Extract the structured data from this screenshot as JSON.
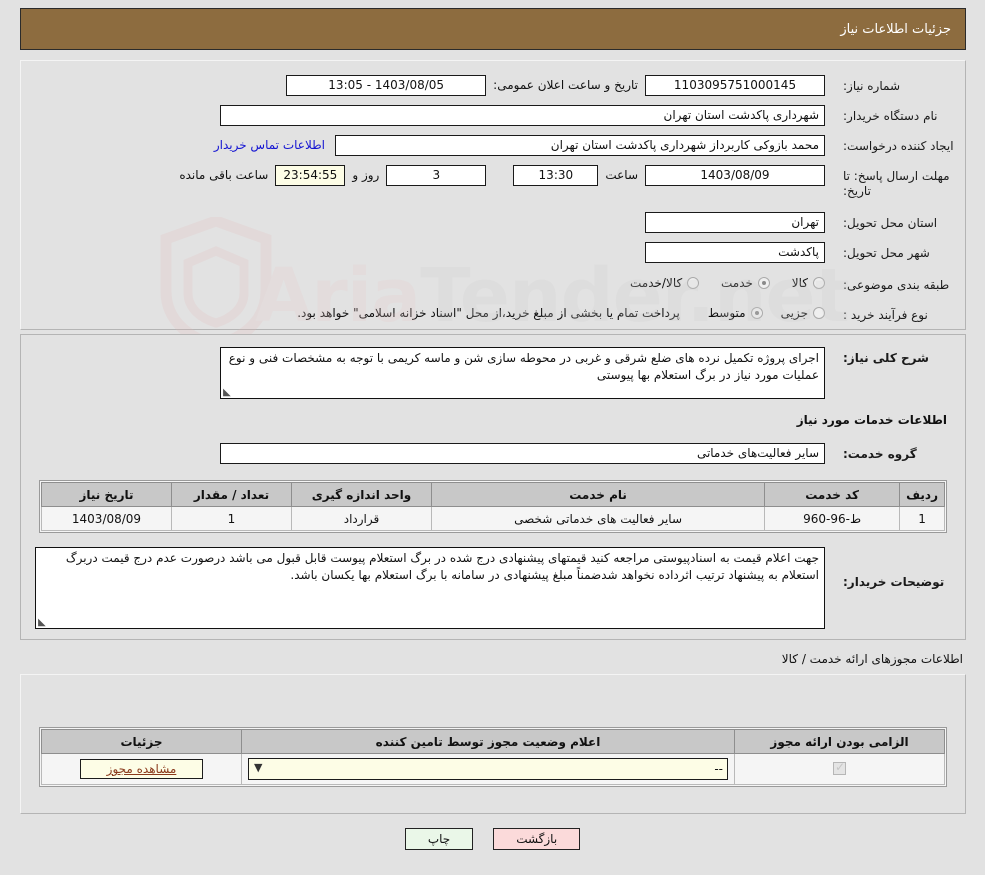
{
  "header": {
    "title": "جزئیات اطلاعات نیاز"
  },
  "fields": {
    "need_number_label": "شماره نیاز:",
    "need_number_value": "1103095751000145",
    "public_announce_label": "تاریخ و ساعت اعلان عمومی:",
    "public_announce_value": "1403/08/05 - 13:05",
    "buyer_org_label": "نام دستگاه خریدار:",
    "buyer_org_value": "شهرداری پاکدشت استان تهران",
    "requester_label": "ایجاد کننده درخواست:",
    "requester_value": "محمد بازوکی کاربرداز شهرداری پاکدشت استان تهران",
    "buyer_contact_link": "اطلاعات تماس خریدار",
    "deadline_label": "مهلت ارسال پاسخ: تا تاریخ:",
    "deadline_date": "1403/08/09",
    "deadline_hour_label": "ساعت",
    "deadline_hour": "13:30",
    "remaining_days": "3",
    "remaining_days_label": "روز و",
    "remaining_time": "23:54:55",
    "remaining_time_label": "ساعت باقی مانده",
    "province_label": "استان محل تحویل:",
    "province_value": "تهران",
    "city_label": "شهر محل تحویل:",
    "city_value": "پاکدشت",
    "category_label": "طبقه بندی موضوعی:",
    "process_label": "نوع فرآیند خرید :",
    "treasury_note": "پرداخت تمام یا بخشی از مبلغ خرید،از محل \"اسناد خزانه اسلامی\" خواهد بود."
  },
  "category_options": [
    {
      "label": "کالا",
      "selected": false
    },
    {
      "label": "خدمت",
      "selected": true
    },
    {
      "label": "کالا/خدمت",
      "selected": false
    }
  ],
  "process_options": [
    {
      "label": "جزیی",
      "selected": false
    },
    {
      "label": "متوسط",
      "selected": true
    }
  ],
  "description": {
    "label": "شرح کلی نیاز:",
    "value": "اجرای پروژه تکمیل نرده های ضلع شرقی و غربی در محوطه سازی شن و ماسه کریمی با توجه به مشخصات فنی و نوع عملیات مورد نیاز در برگ استعلام بها پیوستی"
  },
  "services_section": {
    "heading": "اطلاعات خدمات مورد نیاز",
    "group_label": "گروه خدمت:",
    "group_value": "سایر فعالیت‌های خدماتی"
  },
  "services_table": {
    "columns": [
      "ردیف",
      "کد خدمت",
      "نام خدمت",
      "واحد اندازه گیری",
      "تعداد / مقدار",
      "تاریخ نیاز"
    ],
    "rows": [
      {
        "index": "1",
        "code": "ط-96-960",
        "name": "سایر فعالیت های خدماتی شخصی",
        "unit": "قرارداد",
        "quantity": "1",
        "need_date": "1403/08/09"
      }
    ]
  },
  "buyer_notes": {
    "label": "توضیحات خریدار:",
    "value": "جهت اعلام قیمت به اسنادپیوستی مراجعه کنید قیمتهای پیشنهادی درج شده در برگ استعلام پیوست قابل قبول می باشد درصورت عدم درج قیمت دربرگ استعلام به پیشنهاد ترتیب اثرداده نخواهد شدضمناً مبلغ پیشنهادی در سامانه با برگ استعلام بها یکسان باشد."
  },
  "permits": {
    "section_label": "اطلاعات مجوزهای ارائه خدمت / کالا",
    "columns": [
      "الزامی بودن ارائه مجوز",
      "اعلام وضعیت مجوز توسط تامین کننده",
      "جزئیات"
    ],
    "rows": [
      {
        "required_checked": true,
        "status_value": "--",
        "detail_label": "مشاهده مجوز"
      }
    ]
  },
  "footer": {
    "print_label": "چاپ",
    "back_label": "بازگشت"
  },
  "watermark": {
    "text_left": "Aria",
    "text_right": "Tender",
    "text_tail": ".net"
  },
  "colors": {
    "header_bg": "#8d6c3f",
    "link": "#1414d2",
    "print_btn": "#eaf7e8",
    "back_btn": "#fbdada",
    "cream_field": "#fdfde6"
  }
}
